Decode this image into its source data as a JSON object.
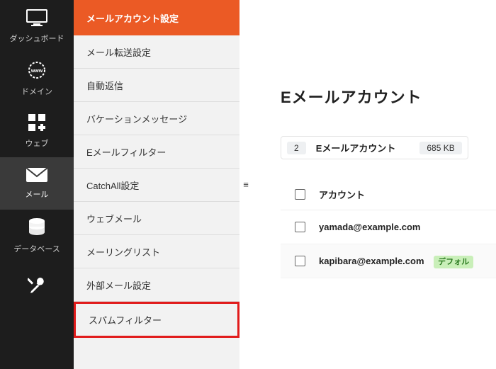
{
  "sidebar": {
    "items": [
      {
        "label": "ダッシュボード"
      },
      {
        "label": "ドメイン"
      },
      {
        "label": "ウェブ"
      },
      {
        "label": "メール"
      },
      {
        "label": "データベース"
      },
      {
        "label": ""
      }
    ]
  },
  "submenu": {
    "header": "メールアカウント設定",
    "items": [
      "メール転送設定",
      "自動返信",
      "バケーションメッセージ",
      "Eメールフィルター",
      "CatchAll設定",
      "ウェブメール",
      "メーリングリスト",
      "外部メール設定",
      "スパムフィルター"
    ]
  },
  "main": {
    "title": "Eメールアカウント",
    "summary": {
      "count": "2",
      "label": "Eメールアカウント",
      "size": "685 KB"
    },
    "table": {
      "header_account": "アカウント",
      "rows": [
        {
          "account": "yamada@example.com",
          "default": false
        },
        {
          "account": "kapibara@example.com",
          "default": true
        }
      ],
      "default_tag": "デフォル"
    }
  },
  "icons": {
    "handle": "≡"
  }
}
